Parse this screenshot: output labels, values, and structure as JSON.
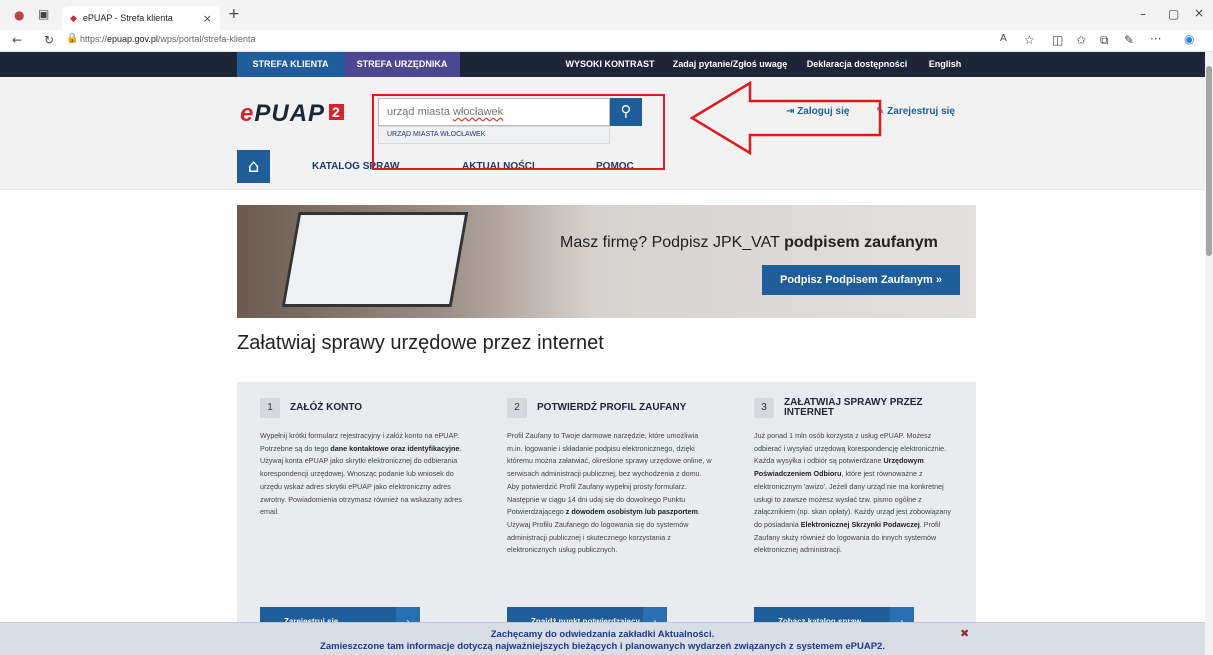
{
  "browser": {
    "tab_title": "ePUAP - Strefa klienta",
    "url_prefix": "https://",
    "url_domain": "epuap.gov.pl",
    "url_path": "/wps/portal/strefa-klienta"
  },
  "topnav": {
    "strefa_klienta": "STREFA KLIENTA",
    "strefa_urzednika": "STREFA URZĘDNIKA",
    "wysoki_kontrast": "WYSOKI KONTRAST",
    "zadaj_pytanie": "Zadaj pytanie/Zgłoś uwagę",
    "deklaracja": "Deklaracja dostępności",
    "english": "English"
  },
  "header": {
    "logo_text": "ePUAP",
    "logo_e": "e",
    "logo_rest": "PUAP",
    "logo_num": "2",
    "search_value_a": "urząd miasta ",
    "search_value_b": "włocławek",
    "suggestion": "URZĄD MIASTA WŁOCŁAWEK",
    "login": "Zaloguj się",
    "register": "Zarejestruj się"
  },
  "menu": {
    "items": [
      "KATALOG SPRAW",
      "AKTUALNOŚCI",
      "POMOC"
    ]
  },
  "banner": {
    "title_a": "Masz firmę? Podpisz JPK_VAT ",
    "title_b": "podpisem zaufanym",
    "button": "Podpisz Podpisem Zaufanym »"
  },
  "main": {
    "heading": "Załatwiaj sprawy urzędowe przez internet"
  },
  "cards": [
    {
      "num": "1",
      "title": "ZAŁÓŻ KONTO",
      "button": "Zarejestruj się"
    },
    {
      "num": "2",
      "title": "POTWIERDŹ PROFIL ZAUFANY",
      "button": "Znajdź punkt potwierdzający"
    },
    {
      "num": "3",
      "title": "ZAŁATWIAJ SPRAWY PRZEZ INTERNET",
      "button": "Zobacz katalog spraw"
    }
  ],
  "card_texts": {
    "c1a": "Wypełnij krótki formularz rejestracyjny i załóż konto na ePUAP. Potrzebne są do tego ",
    "c1b": "dane kontaktowe oraz identyfikacyjne",
    "c1c": ". Używaj konta ePUAP jako skrytki elektronicznej do odbierania korespondencji urzędowej. Wnosząc podanie lub wniosek do urzędu wskaż adres skrytki ePUAP jako elektroniczny adres zwrotny. Powiadomienia otrzymasz również na wskazany adres email.",
    "c2a": "Profil Zaufany to Twoje darmowe narzędzie, które umożliwia m.in. logowanie i składanie podpisu elektronicznego, dzięki któremu można załatwiać, określone sprawy urzędowe online, w serwisach administracji publicznej, bez wychodzenia z domu. Aby potwierdzić Profil Zaufany wypełnij prosty formularz. Następnie w ciągu 14 dni udaj się do dowolnego Punktu Potwierdzającego ",
    "c2b": "z dowodem osobistym lub paszportem",
    "c2c": ". Używaj Profilu Zaufanego do logowania się do systemów administracji publicznej i skutecznego korzystania z elektronicznych usług publicznych.",
    "c3a": "Już ponad 1 mln osób korzysta z usług ePUAP. Możesz odbierać i wysyłać urzędową korespondencję elektronicznie. Każda wysyłka i odbiór są potwierdzane ",
    "c3b": "Urzędowym Poświadczeniem Odbioru",
    "c3c": ", które jest równoważne z elektronicznym 'awizo'. Jeżeli dany urząd nie ma konkretnej usługi to zawsze możesz wysłać tzw. pismo ogólne z załącznikiem (np. skan opłaty). Każdy urząd jest zobowiązany do posiadania ",
    "c3d": "Elektronicznej Skrzynki Podawczej",
    "c3e": ". Profil Zaufany służy również do logowania do innych systemów elektronicznej administracji."
  },
  "footer": {
    "line1": "Zachęcamy do odwiedzania zakładki Aktualności.",
    "line2": "Zamieszczone tam informacje dotyczą najważniejszych bieżących i planowanych wydarzeń związanych z systemem ePUAP2."
  },
  "colors": {
    "navy": "#1e2538",
    "blue": "#1f5d9b",
    "red": "#d7232b",
    "highlight": "#e0191f"
  }
}
